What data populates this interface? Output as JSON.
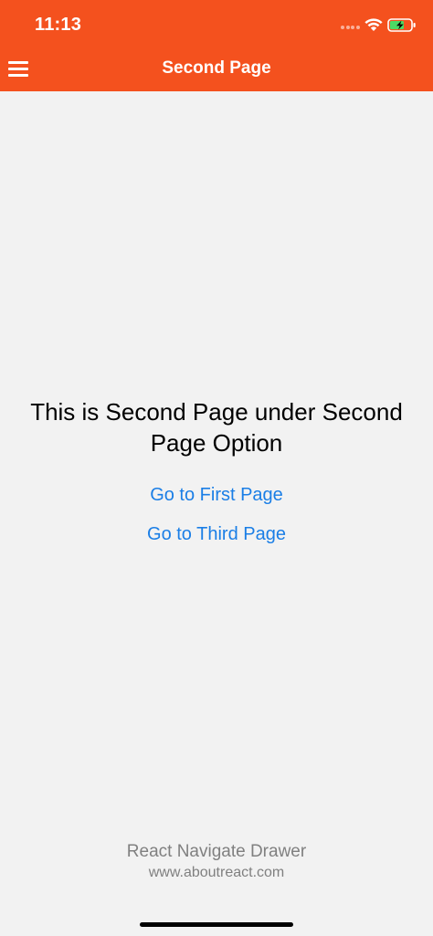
{
  "status_bar": {
    "time": "11:13",
    "icons": [
      "signal-dots-icon",
      "wifi-icon",
      "battery-charging-icon"
    ]
  },
  "header": {
    "title": "Second Page",
    "menu_icon": "hamburger-menu-icon",
    "background_color": "#f4511e",
    "text_color": "#ffffff"
  },
  "main": {
    "message": "This is Second Page under Second Page Option",
    "links": [
      {
        "label": "Go to First Page"
      },
      {
        "label": "Go to Third Page"
      }
    ],
    "link_color": "#1a7ee6"
  },
  "footer": {
    "line1": "React Navigate Drawer",
    "line2": "www.aboutreact.com"
  }
}
